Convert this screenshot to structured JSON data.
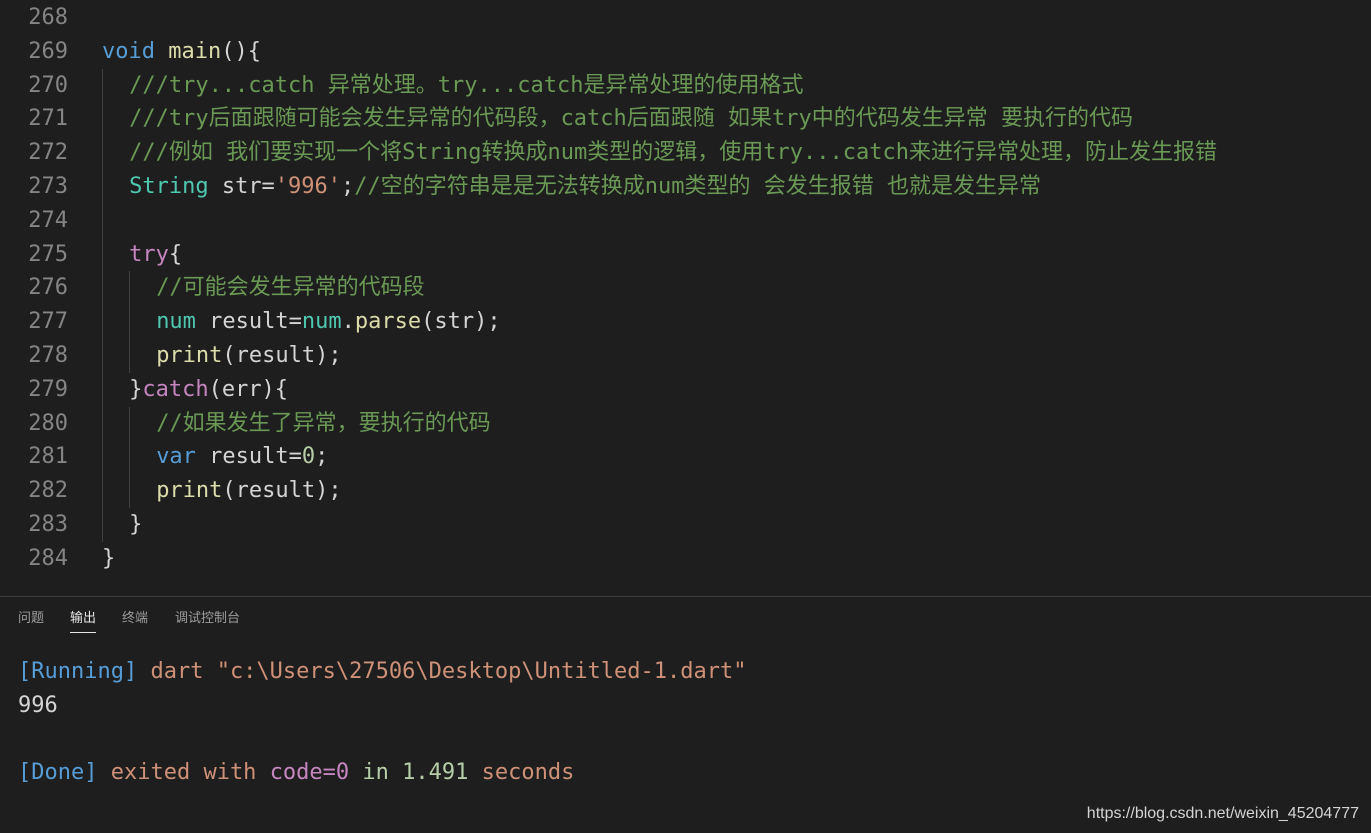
{
  "editor": {
    "lines": [
      {
        "n": "268",
        "indent": 0,
        "tokens": []
      },
      {
        "n": "269",
        "indent": 0,
        "tokens": [
          {
            "t": "void",
            "c": "kw"
          },
          {
            "t": " ",
            "c": "plain"
          },
          {
            "t": "main",
            "c": "fn"
          },
          {
            "t": "(){",
            "c": "plain"
          }
        ]
      },
      {
        "n": "270",
        "indent": 1,
        "tokens": [
          {
            "t": "///try...catch 异常处理。try...catch是异常处理的使用格式",
            "c": "com"
          }
        ]
      },
      {
        "n": "271",
        "indent": 1,
        "tokens": [
          {
            "t": "///try后面跟随可能会发生异常的代码段，catch后面跟随 如果try中的代码发生异常 要执行的代码",
            "c": "com"
          }
        ]
      },
      {
        "n": "272",
        "indent": 1,
        "tokens": [
          {
            "t": "///例如 我们要实现一个将String转换成num类型的逻辑，使用try...catch来进行异常处理，防止发生报错",
            "c": "com"
          }
        ]
      },
      {
        "n": "273",
        "indent": 1,
        "tokens": [
          {
            "t": "String",
            "c": "ty"
          },
          {
            "t": " str=",
            "c": "plain"
          },
          {
            "t": "'996'",
            "c": "str"
          },
          {
            "t": ";",
            "c": "plain"
          },
          {
            "t": "//空的字符串是是无法转换成num类型的 会发生报错 也就是发生异常",
            "c": "com"
          }
        ]
      },
      {
        "n": "274",
        "indent": 1,
        "tokens": []
      },
      {
        "n": "275",
        "indent": 1,
        "tokens": [
          {
            "t": "try",
            "c": "ctrl"
          },
          {
            "t": "{",
            "c": "plain"
          }
        ]
      },
      {
        "n": "276",
        "indent": 2,
        "tokens": [
          {
            "t": "//可能会发生异常的代码段",
            "c": "com"
          }
        ]
      },
      {
        "n": "277",
        "indent": 2,
        "tokens": [
          {
            "t": "num",
            "c": "ty"
          },
          {
            "t": " result=",
            "c": "plain"
          },
          {
            "t": "num",
            "c": "ty"
          },
          {
            "t": ".",
            "c": "plain"
          },
          {
            "t": "parse",
            "c": "fn"
          },
          {
            "t": "(str);",
            "c": "plain"
          }
        ]
      },
      {
        "n": "278",
        "indent": 2,
        "tokens": [
          {
            "t": "print",
            "c": "fn"
          },
          {
            "t": "(result);",
            "c": "plain"
          }
        ]
      },
      {
        "n": "279",
        "indent": 1,
        "tokens": [
          {
            "t": "}",
            "c": "plain"
          },
          {
            "t": "catch",
            "c": "ctrl"
          },
          {
            "t": "(err){",
            "c": "plain"
          }
        ]
      },
      {
        "n": "280",
        "indent": 2,
        "tokens": [
          {
            "t": "//如果发生了异常，要执行的代码",
            "c": "com"
          }
        ]
      },
      {
        "n": "281",
        "indent": 2,
        "tokens": [
          {
            "t": "var",
            "c": "kw"
          },
          {
            "t": " result=",
            "c": "plain"
          },
          {
            "t": "0",
            "c": "num"
          },
          {
            "t": ";",
            "c": "plain"
          }
        ]
      },
      {
        "n": "282",
        "indent": 2,
        "tokens": [
          {
            "t": "print",
            "c": "fn"
          },
          {
            "t": "(result);",
            "c": "plain"
          }
        ]
      },
      {
        "n": "283",
        "indent": 1,
        "tokens": [
          {
            "t": "}",
            "c": "plain"
          }
        ]
      },
      {
        "n": "284",
        "indent": 0,
        "tokens": [
          {
            "t": "}",
            "c": "plain"
          }
        ]
      }
    ]
  },
  "panel": {
    "tabs": [
      {
        "label": "问题",
        "active": false
      },
      {
        "label": "输出",
        "active": true
      },
      {
        "label": "终端",
        "active": false
      },
      {
        "label": "调试控制台",
        "active": false
      }
    ]
  },
  "output": {
    "running_tag": "[Running]",
    "running_cmd": "dart \"c:\\Users\\27506\\Desktop\\Untitled-1.dart\"",
    "result": "996",
    "done_tag": "[Done]",
    "done_exited": "exited with",
    "done_code": "code=0",
    "done_in": "in",
    "done_time": "1.491",
    "done_seconds": "seconds"
  },
  "watermark": "https://blog.csdn.net/weixin_45204777"
}
